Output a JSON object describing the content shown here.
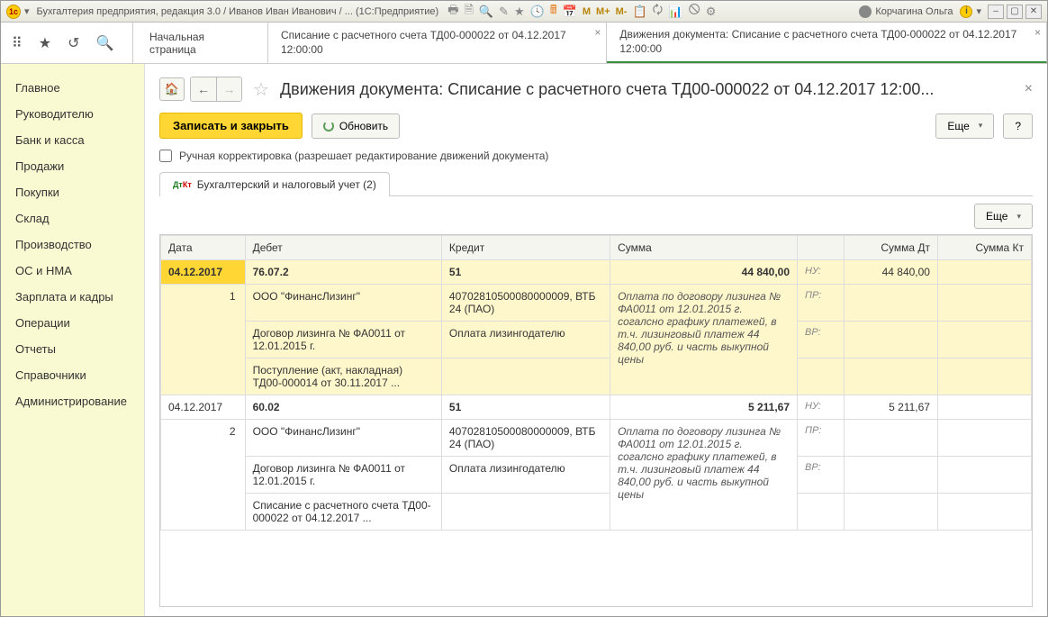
{
  "titlebar": {
    "title": "Бухгалтерия предприятия, редакция 3.0 / Иванов Иван Иванович / ...  (1С:Предприятие)",
    "user": "Корчагина Ольга",
    "m_labels": [
      "M",
      "M+",
      "M-"
    ]
  },
  "tabs": {
    "start": "Начальная страница",
    "t1": "Списание с расчетного счета ТД00-000022 от 04.12.2017 12:00:00",
    "t2": "Движения документа: Списание с расчетного счета ТД00-000022 от 04.12.2017 12:00:00"
  },
  "sidebar": {
    "items": [
      "Главное",
      "Руководителю",
      "Банк и касса",
      "Продажи",
      "Покупки",
      "Склад",
      "Производство",
      "ОС и НМА",
      "Зарплата и кадры",
      "Операции",
      "Отчеты",
      "Справочники",
      "Администрирование"
    ]
  },
  "header": {
    "title": "Движения документа: Списание с расчетного счета ТД00-000022 от 04.12.2017 12:00..."
  },
  "actions": {
    "save_close": "Записать и закрыть",
    "refresh": "Обновить",
    "more": "Еще",
    "help": "?"
  },
  "checkbox": {
    "label": "Ручная корректировка (разрешает редактирование движений документа)"
  },
  "pagetab": {
    "label": "Бухгалтерский и налоговый учет (2)",
    "dt": "Дт",
    "kt": "Кт"
  },
  "table": {
    "headers": {
      "date": "Дата",
      "debet": "Дебет",
      "kredit": "Кредит",
      "sum": "Сумма",
      "sum_dt": "Сумма Дт",
      "sum_kt": "Сумма Кт"
    },
    "labels": {
      "nu": "НУ:",
      "pr": "ПР:",
      "vr": "ВР:"
    },
    "rows": [
      {
        "date": "04.12.2017",
        "idx": "1",
        "debet_acc": "76.07.2",
        "debet_sub1": "ООО \"ФинансЛизинг\"",
        "debet_sub2": "Договор лизинга № ФА0011 от 12.01.2015 г.",
        "debet_sub3": "Поступление (акт, накладная) ТД00-000014 от 30.11.2017 ...",
        "kredit_acc": "51",
        "kredit_sub1": "40702810500080000009, ВТБ 24 (ПАО)",
        "kredit_sub2": "Оплата лизингодателю",
        "sum": "44 840,00",
        "sum_dt_nu": "44 840,00",
        "descr": "Оплата по договору лизинга № ФА0011 от 12.01.2015 г. согалсно графику платежей, в т.ч. лизинговый платеж 44 840,00 руб. и часть выкупной цены"
      },
      {
        "date": "04.12.2017",
        "idx": "2",
        "debet_acc": "60.02",
        "debet_sub1": "ООО \"ФинансЛизинг\"",
        "debet_sub2": "Договор лизинга № ФА0011 от 12.01.2015 г.",
        "debet_sub3": "Списание с расчетного счета ТД00-000022 от 04.12.2017 ...",
        "kredit_acc": "51",
        "kredit_sub1": "40702810500080000009, ВТБ 24 (ПАО)",
        "kredit_sub2": "Оплата лизингодателю",
        "sum": "5 211,67",
        "sum_dt_nu": "5 211,67",
        "descr": "Оплата по договору лизинга № ФА0011 от 12.01.2015 г. согалсно графику платежей, в т.ч. лизинговый платеж 44 840,00 руб. и часть выкупной цены"
      }
    ]
  }
}
